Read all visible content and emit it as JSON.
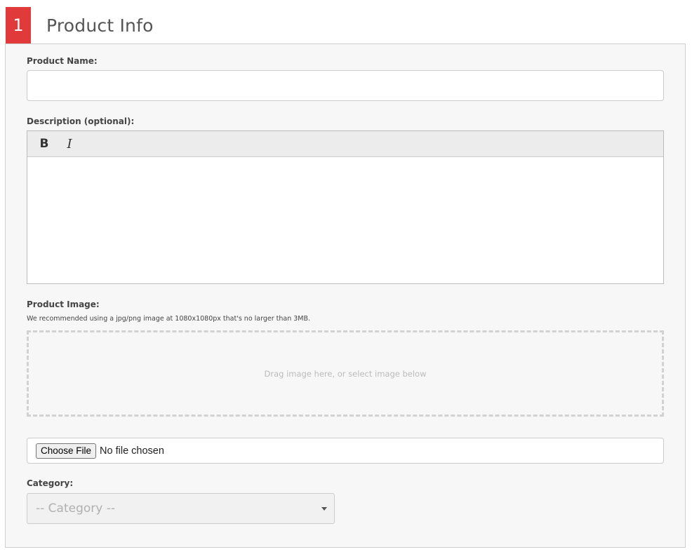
{
  "header": {
    "step_number": "1",
    "title": "Product Info"
  },
  "form": {
    "product_name": {
      "label": "Product Name:",
      "value": ""
    },
    "description": {
      "label": "Description (optional):",
      "toolbar": {
        "bold_label": "B",
        "italic_label": "I"
      },
      "value": ""
    },
    "product_image": {
      "label": "Product Image:",
      "help": "We recommended using a jpg/png image at 1080x1080px that's no larger than 3MB.",
      "dropzone_text": "Drag image here, or select image below",
      "choose_button": "Choose File",
      "file_status": "No file chosen"
    },
    "category": {
      "label": "Category:",
      "selected": "-- Category --"
    }
  },
  "colors": {
    "step_badge": "#e03a3a",
    "panel_background": "#f7f7f7"
  },
  "icons": {
    "bold": "bold-icon",
    "italic": "italic-icon",
    "select_caret": "caret-down-icon"
  }
}
